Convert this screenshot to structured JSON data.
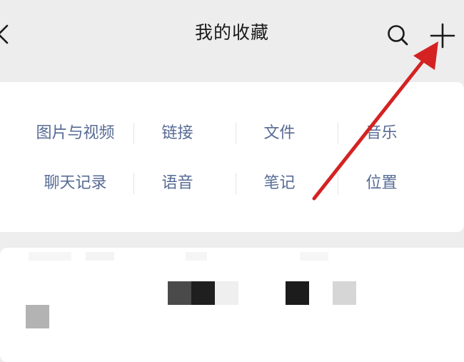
{
  "header": {
    "title": "我的收藏"
  },
  "categories": {
    "row1": [
      "图片与视频",
      "链接",
      "文件",
      "音乐"
    ],
    "row2": [
      "聊天记录",
      "语音",
      "笔记",
      "位置"
    ]
  },
  "colors": {
    "background": "#ededed",
    "card": "#ffffff",
    "link_text": "#576b95",
    "title_text": "#1a1a1a",
    "annotation_arrow": "#d42222"
  },
  "icons": {
    "back": "chevron-left-icon",
    "search": "search-icon",
    "add": "plus-icon"
  }
}
